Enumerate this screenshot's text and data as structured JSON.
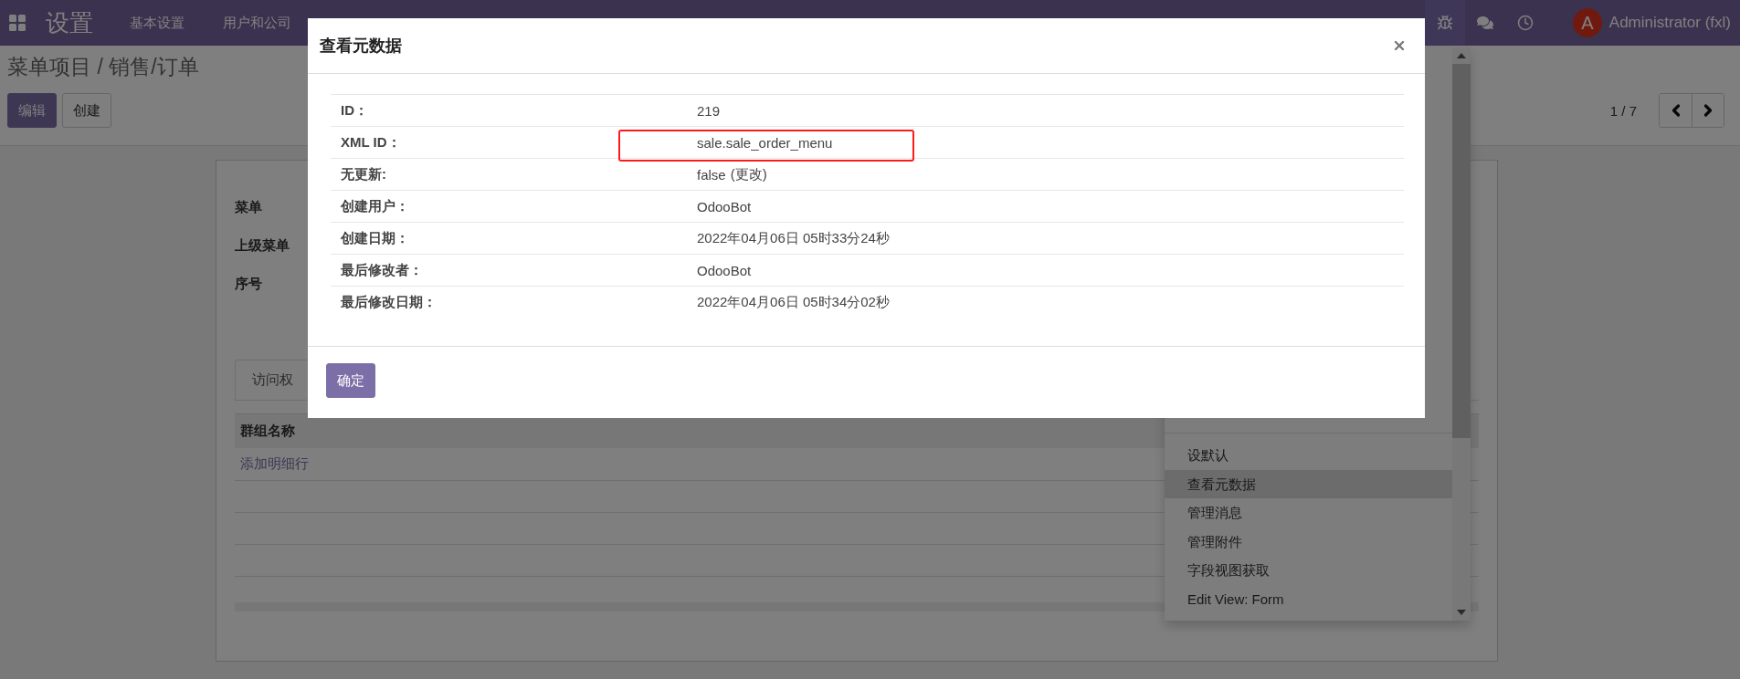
{
  "navbar": {
    "app_title": "设置",
    "menu": [
      "基本设置",
      "用户和公司"
    ],
    "user": {
      "avatar_letter": "A",
      "name": "Administrator (fxl)"
    }
  },
  "breadcrumb": "菜单项目 / 销售/订单",
  "buttons": [
    {
      "label": "编辑",
      "kind": "primary"
    },
    {
      "label": "创建",
      "kind": "secondary"
    }
  ],
  "pager": "1 / 7",
  "form": {
    "fields": [
      "菜单",
      "上级菜单",
      "序号"
    ],
    "tabs": [
      {
        "label": "访问权",
        "selected": true
      }
    ],
    "table": {
      "columns": [
        "群组名称"
      ],
      "add_line": "添加明细行"
    }
  },
  "debug_menu": {
    "items": [
      {
        "label": "设默认",
        "selected": false
      },
      {
        "label": "查看元数据",
        "selected": true
      },
      {
        "label": "管理消息",
        "selected": false
      },
      {
        "label": "管理附件",
        "selected": false
      },
      {
        "label": "字段视图获取",
        "selected": false
      },
      {
        "label": "Edit View: Form",
        "selected": false
      }
    ]
  },
  "dialog": {
    "title": "查看元数据",
    "rows": [
      {
        "label": "ID：",
        "value": "219",
        "highlighted": false
      },
      {
        "label": "XML ID：",
        "value": "sale.sale_order_menu",
        "highlighted": true
      },
      {
        "label": "无更新:",
        "value": "false",
        "link": "(更改)",
        "highlighted": false
      },
      {
        "label": "创建用户：",
        "value": "OdooBot",
        "highlighted": false
      },
      {
        "label": "创建日期：",
        "value": "2022年04月06日 05时33分24秒",
        "highlighted": false
      },
      {
        "label": "最后修改者：",
        "value": "OdooBot",
        "highlighted": false
      },
      {
        "label": "最后修改日期：",
        "value": "2022年04月06日 05时34分02秒",
        "highlighted": false
      }
    ],
    "confirm": "确定"
  }
}
